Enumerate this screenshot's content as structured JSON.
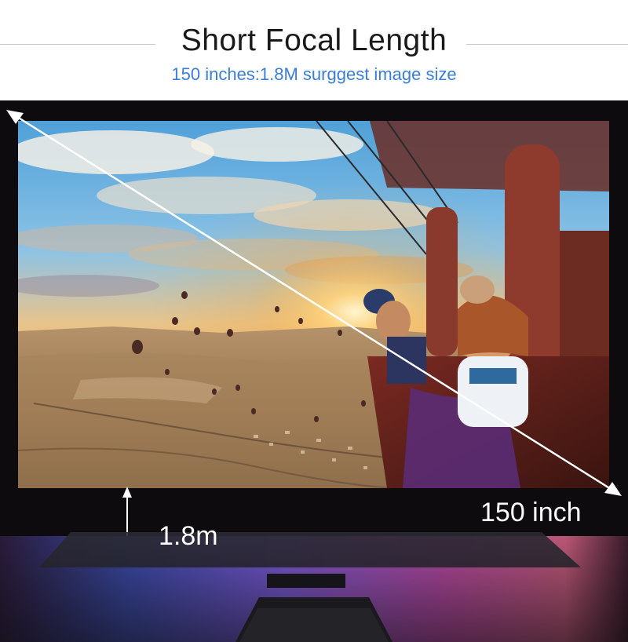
{
  "header": {
    "title": "Short Focal Length",
    "subtitle": "150 inches:1.8M surggest image size"
  },
  "screen": {
    "size_label": "150 inch",
    "distance_label": "1.8m",
    "scene": "hot air balloon over valley at sunset"
  },
  "colors": {
    "subtitle": "#3b7fd4",
    "stage": "#0d0b0d",
    "arrow": "#ffffff"
  }
}
